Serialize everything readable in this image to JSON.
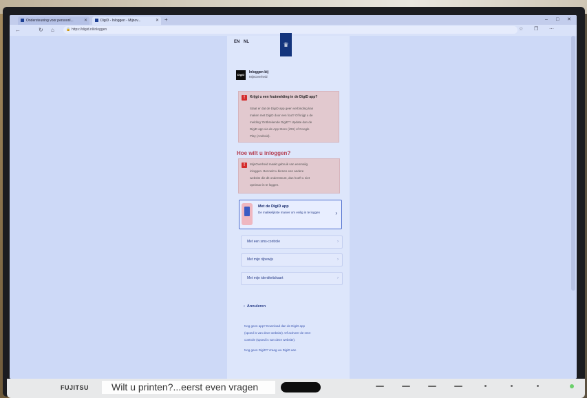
{
  "browser": {
    "tabs": [
      {
        "label": "Ondersteuning voor persoonl..."
      },
      {
        "label": "DigiD - Inloggen - Mijnov..."
      }
    ],
    "url": "https://digid.nl/inloggen"
  },
  "page": {
    "lang_en": "EN",
    "lang_nl": "NL",
    "logo_glyph": "♛",
    "app": {
      "icon_text": "DigiD",
      "name": "Inloggen bij",
      "sub": "MijnOverheid"
    },
    "warning1": {
      "title": "Krijgt u een foutmelding in de DigiD app?",
      "lines": [
        "Staat er dat de DigiD app geen verbinding kan",
        "maken met DigiD door een fout? Of krijgt u de",
        "melding 'Ontbrekende DigiD'? Update dan de",
        "DigiD app via de App Store (iOS) of Google",
        "Play (Android)."
      ]
    },
    "heading": "Hoe wilt u inloggen?",
    "warning2": {
      "lines": [
        "MijnOverheid maakt gebruik van eenmalig",
        "inloggen. Bezoekt u binnen een andere",
        "website die dit ondersteunt, dan hoeft u niet",
        "opnieuw in te loggen."
      ]
    },
    "option_app": {
      "title": "Met de DigiD app",
      "desc": "De makkelijkste manier om veilig in te loggen"
    },
    "options": [
      {
        "label": "Met een sms-controle"
      },
      {
        "label": "Met mijn rijbewijs"
      },
      {
        "label": "Met mijn identiteitskaart"
      }
    ],
    "cancel": "Annuleren",
    "footer": [
      "Nog geen app? Download dan de DigiD app",
      "(spoed is van deze website). Of activeer de sms-",
      "controle (spoed is van deze website).",
      "Nog geen DigiD? Vraag uw DigiD aan"
    ]
  },
  "monitor": {
    "brand": "FUJITSU",
    "sticker": "Wilt u printen?...eerst even vragen"
  }
}
